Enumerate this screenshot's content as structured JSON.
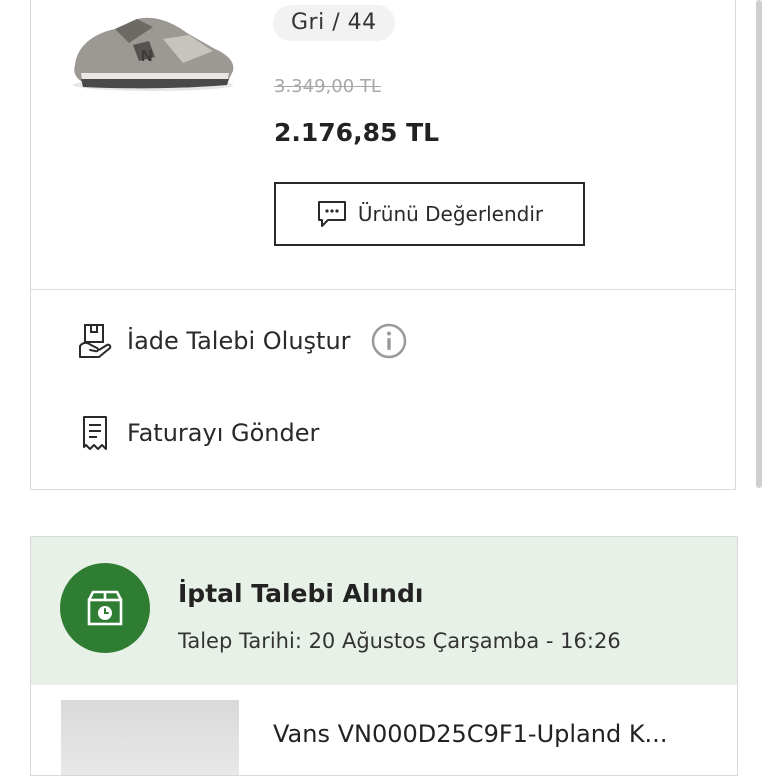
{
  "order_item": {
    "variant": "Gri / 44",
    "old_price": "3.349,00 TL",
    "new_price": "2.176,85 TL",
    "review_label": "Ürünü Değerlendir",
    "icons": {
      "product_image": "sneaker-photo",
      "review": "chat-bubble-icon"
    }
  },
  "actions": [
    {
      "label": "İade Talebi Oluştur",
      "icon": "return-box-icon",
      "extra_icon": "info-icon"
    },
    {
      "label": "Faturayı Gönder",
      "icon": "receipt-icon"
    }
  ],
  "cancel_request": {
    "title": "İptal Talebi Alındı",
    "date": "Talep Tarihi: 20 Ağustos Çarşamba - 16:26",
    "icon": "box-clock-icon",
    "accent_color": "#2e7d32",
    "band_color": "#e8f1e8",
    "product_name": "Vans VN000D25C9F1-Upland K..."
  }
}
